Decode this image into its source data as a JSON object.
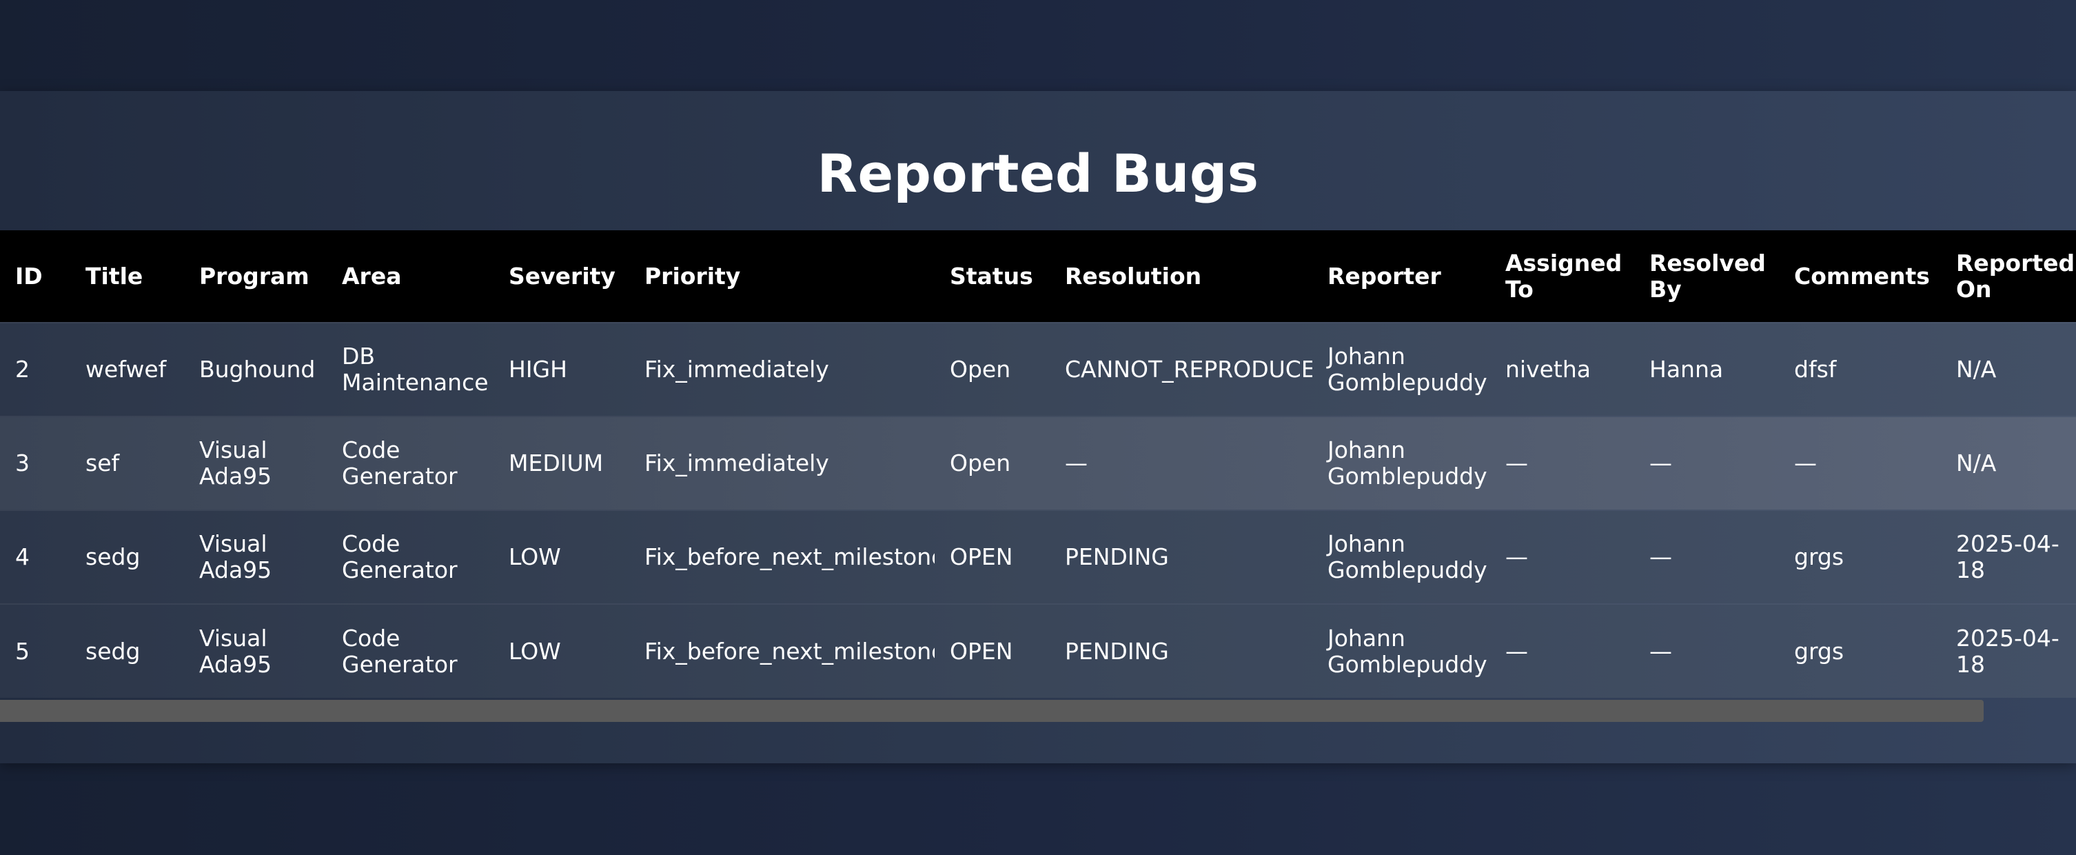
{
  "page": {
    "title": "Reported Bugs"
  },
  "table": {
    "columns": [
      "ID",
      "Title",
      "Program",
      "Area",
      "Severity",
      "Priority",
      "Status",
      "Resolution",
      "Reporter",
      "Assigned To",
      "Resolved By",
      "Comments",
      "Reported On"
    ],
    "rows": [
      [
        "2",
        "wefwef",
        "Bughound",
        "DB Maintenance",
        "HIGH",
        "Fix_immediately",
        "Open",
        "CANNOT_REPRODUCE",
        "Johann Gomblepuddy",
        "nivetha",
        "Hanna",
        "dfsf",
        "N/A"
      ],
      [
        "3",
        "sef",
        "Visual Ada95",
        "Code Generator",
        "MEDIUM",
        "Fix_immediately",
        "Open",
        "—",
        "Johann Gomblepuddy",
        "—",
        "—",
        "—",
        "N/A"
      ],
      [
        "4",
        "sedg",
        "Visual Ada95",
        "Code Generator",
        "LOW",
        "Fix_before_next_milestone",
        "OPEN",
        "PENDING",
        "Johann Gomblepuddy",
        "—",
        "—",
        "grgs",
        "2025-04-18"
      ],
      [
        "5",
        "sedg",
        "Visual Ada95",
        "Code Generator",
        "LOW",
        "Fix_before_next_milestone",
        "OPEN",
        "PENDING",
        "Johann Gomblepuddy",
        "—",
        "—",
        "grgs",
        "2025-04-18"
      ]
    ]
  }
}
